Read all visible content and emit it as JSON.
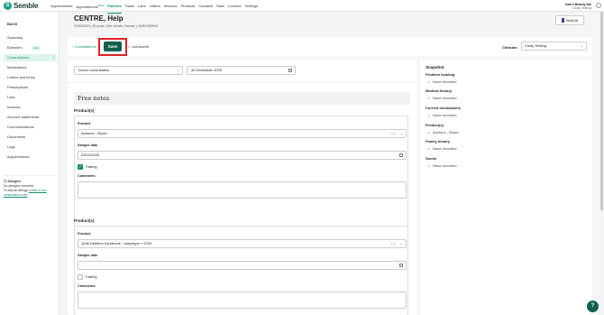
{
  "app": {
    "logo_text": "Semble",
    "logo_mark": "S"
  },
  "nav": {
    "items": [
      "Appointments",
      "Appointments",
      "Patients",
      "Tasks",
      "Labs",
      "Letters",
      "Invoices",
      "Products",
      "Contacts",
      "Data",
      "Connect",
      "Settings"
    ],
    "beta_sup": "Beta",
    "active": "Patients"
  },
  "user": {
    "name": "Cam's Beauty bar",
    "role": "Cindy Testing"
  },
  "sidebar": {
    "back": "BACK",
    "items": [
      "Summary",
      "Episodes",
      "Consultations",
      "Medications",
      "Letters and forms",
      "Prescriptions",
      "Labs",
      "Invoices",
      "Account statements",
      "Communications",
      "Documents",
      "Logs",
      "Appointments"
    ],
    "episodes_badge": "beta",
    "allergies": {
      "title": "Allergies",
      "none": "No allergies recorded",
      "add_prefix": "To add an allergy",
      "add_link": "create a new consultation note"
    }
  },
  "patient": {
    "name": "CENTRE, Help",
    "meta": "23/02/2000 | 25 years | Sex at birth: Female | GASC0000HC"
  },
  "heidi_button": "Heidi AI",
  "actionbar": {
    "breadcrumb": "Consultations",
    "save": "Save",
    "autosaved": "Autosaved",
    "clinician_label": "Clinician",
    "clinician_value": "Cindy Testing"
  },
  "consultation": {
    "type": "Doctor consultation",
    "date": "30 December 2025",
    "free_notes_title": "Free notes",
    "products_label": "Product(s)",
    "product_label": "Product",
    "sample_date_label": "Sample date",
    "fasting_label": "Fasting",
    "comments_label": "Comments",
    "show_in_summary": "Show in summary",
    "delete_record": "Delete record",
    "product1": {
      "value": "Acetone - Blood",
      "sample_date": "03/12/2025",
      "fasting": true
    },
    "product2": {
      "value": "1p36 Deletion Syndrome - karyotype + CGH",
      "sample_date": "",
      "fasting": false
    }
  },
  "snapshot": {
    "title": "Snapshot",
    "sections": [
      {
        "heading": "Problem heading",
        "value": "None recorded"
      },
      {
        "heading": "Medical history",
        "value": "None recorded"
      },
      {
        "heading": "Current medications",
        "value": "None recorded"
      },
      {
        "heading": "Product(s)",
        "value": "Acetone - Blood"
      },
      {
        "heading": "Family history",
        "value": "None recorded"
      },
      {
        "heading": "Social",
        "value": "None recorded"
      }
    ]
  },
  "help_button": "?",
  "colors": {
    "brand": "#0e8f73",
    "save_button": "#11614f",
    "highlight": "#e02020",
    "delete": "#e02020"
  }
}
